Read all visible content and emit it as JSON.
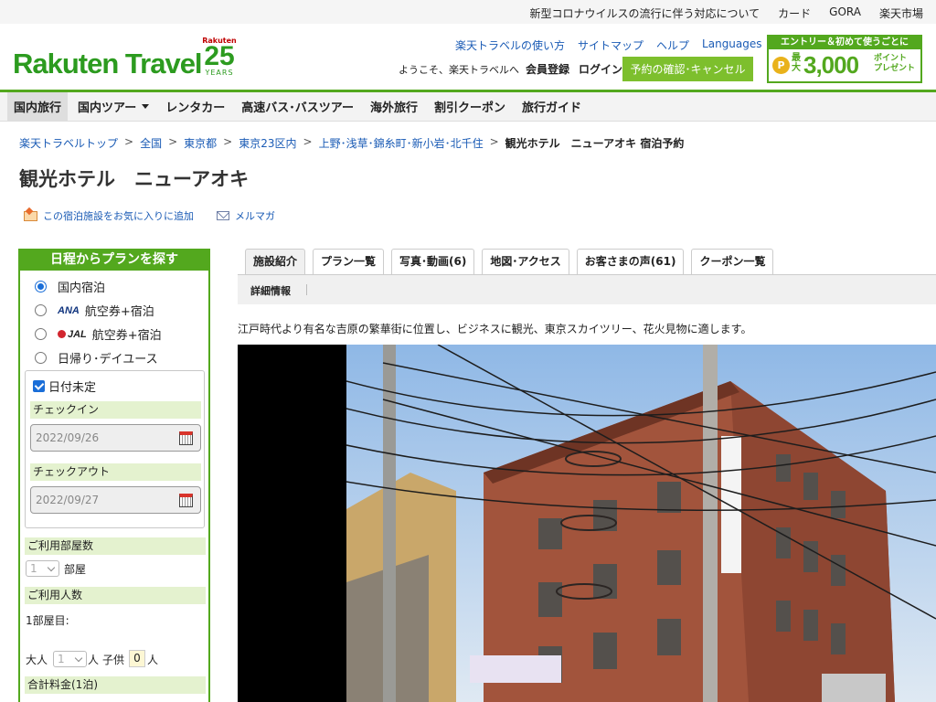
{
  "topbar": {
    "links": [
      "新型コロナウイルスの流行に伴う対応について",
      "カード",
      "GORA",
      "楽天市場"
    ]
  },
  "header": {
    "logo": "Rakuten Travel",
    "badge": {
      "top": "Rakuten",
      "number": "25",
      "bottom": "YEARS"
    },
    "links": [
      "楽天トラベルの使い方",
      "サイトマップ",
      "ヘルプ",
      "Languages"
    ],
    "welcome": "ようこそ、楽天トラベルへ",
    "member": "会員登録",
    "login": "ログイン",
    "reserve": "予約の確認･キャンセル",
    "promo": {
      "top": "エントリー＆初めて使うごとに",
      "coin": "P",
      "max": "最大",
      "amount": "3,000",
      "unit1": "ポイント",
      "unit2": "プレゼント"
    }
  },
  "nav": {
    "items": [
      "国内旅行",
      "国内ツアー",
      "レンタカー",
      "高速バス･バスツアー",
      "海外旅行",
      "割引クーポン",
      "旅行ガイド"
    ],
    "active_index": 0
  },
  "breadcrumb": {
    "items": [
      "楽天トラベルトップ",
      "全国",
      "東京都",
      "東京23区内",
      "上野･浅草･錦糸町･新小岩･北千住"
    ],
    "separator": ">",
    "current": "観光ホテル　ニューアオキ 宿泊予約"
  },
  "hotel": {
    "title": "観光ホテル　ニューアオキ",
    "favorite": "この宿泊施設をお気に入りに追加",
    "mail": "メルマガ",
    "description": "江戸時代より有名な吉原の繁華街に位置し、ビジネスに観光、東京スカイツリー、花火見物に適します。"
  },
  "search_panel": {
    "title": "日程からプランを探す",
    "options": [
      {
        "airline": "",
        "label": "国内宿泊",
        "selected": true
      },
      {
        "airline": "ANA",
        "label": "航空券+宿泊",
        "selected": false
      },
      {
        "airline": "JAL",
        "label": "航空券+宿泊",
        "selected": false
      },
      {
        "airline": "",
        "label": "日帰り･デイユース",
        "selected": false
      }
    ],
    "date_undecided": "日付未定",
    "date_undecided_checked": true,
    "checkin_label": "チェックイン",
    "checkin_value": "2022/09/26",
    "checkout_label": "チェックアウト",
    "checkout_value": "2022/09/27",
    "rooms_label": "ご利用部屋数",
    "rooms_value": "1",
    "rooms_unit": "部屋",
    "guests_label": "ご利用人数",
    "room1_label": "1部屋目:",
    "adult_label": "大人",
    "adult_value": "1",
    "adult_unit": "人",
    "child_label": "子供",
    "child_value": "0",
    "child_unit": "人",
    "total_label": "合計料金(1泊)"
  },
  "tabs": {
    "items": [
      "施設紹介",
      "プラン一覧",
      "写真･動画(6)",
      "地図･アクセス",
      "お客さまの声(61)",
      "クーポン一覧"
    ],
    "active_index": 0,
    "subtab": "詳細情報"
  },
  "colors": {
    "brand_green": "#53a81e",
    "link_blue": "#1a5bb5",
    "light_green": "#e4f2cf"
  }
}
